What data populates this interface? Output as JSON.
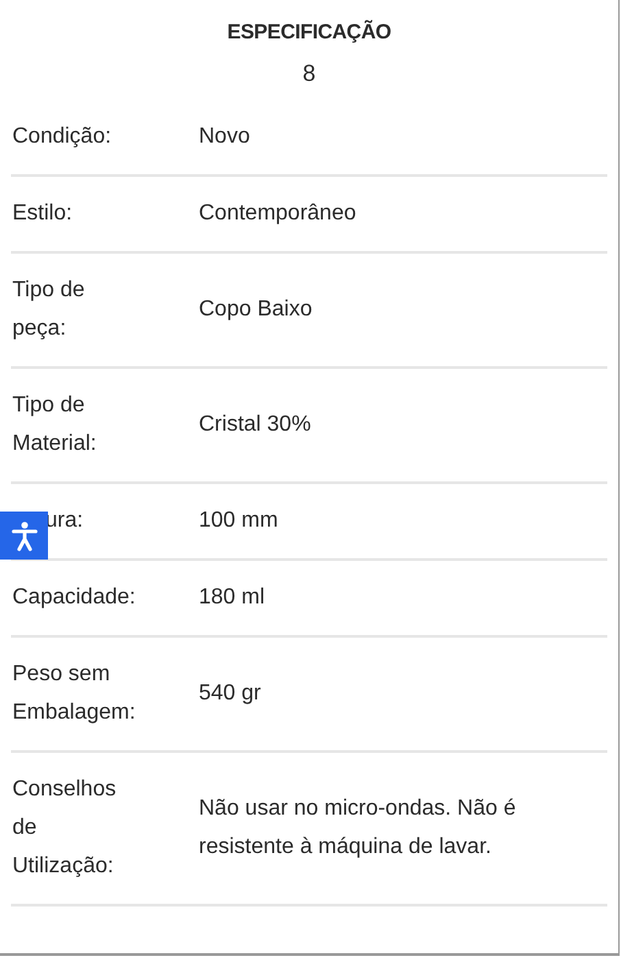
{
  "title": "ESPECIFICAÇÃO",
  "count": "8",
  "rows": [
    {
      "label": "Condição:",
      "value": "Novo"
    },
    {
      "label": "Estilo:",
      "value": "Contemporâneo"
    },
    {
      "label": "Tipo de peça:",
      "value": "Copo Baixo"
    },
    {
      "label": "Tipo de Material:",
      "value": "Cristal 30%"
    },
    {
      "label": "ura:",
      "value": "100 mm",
      "covered": true
    },
    {
      "label": "Capacidade:",
      "value": "180 ml"
    },
    {
      "label": "Peso sem Embalagem:",
      "value": "540 gr"
    },
    {
      "label": "Conselhos de Utilização:",
      "value": "Não usar no micro-ondas. Não é resistente à máquina de lavar."
    }
  ]
}
